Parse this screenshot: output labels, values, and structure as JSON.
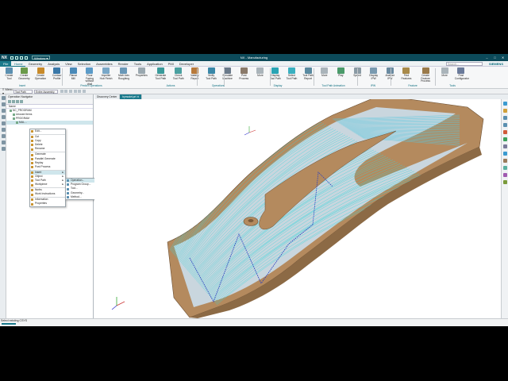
{
  "titlebar": {
    "app": "NX",
    "window_menu": "Window",
    "title": "NX - Manufacturing",
    "brand": "SIEMENS"
  },
  "menu": {
    "file": "File",
    "tabs": [
      "Home",
      "Geometry",
      "Analysis",
      "View",
      "Selection",
      "Assemblies",
      "Render",
      "Tools",
      "Application",
      "PMI",
      "Developer"
    ],
    "search_placeholder": "Search..."
  },
  "ribbon": {
    "buttons": [
      {
        "l1": "Create",
        "l2": "Tool",
        "color": "#5a8fb0"
      },
      {
        "l1": "Create",
        "l2": "Geometry",
        "color": "#6a9a4a"
      },
      {
        "l1": "Create",
        "l2": "Operation",
        "color": "#c88a2a"
      },
      {
        "l1": "Contour",
        "l2": "Profile",
        "color": "#3a78a8"
      },
      {
        "l1": "Planar",
        "l2": "Mill",
        "color": "#4a8ab8"
      },
      {
        "l1": "Floor Facing",
        "l2": "without Wall",
        "color": "#5b9bc8"
      },
      {
        "l1": "Impeller",
        "l2": "Hub Finish",
        "color": "#7aa8c8"
      },
      {
        "l1": "Multi Axis",
        "l2": "Roughing",
        "color": "#6a98b8"
      },
      {
        "l1": "Properties",
        "l2": "",
        "color": "#9aa8b0"
      },
      {
        "l1": "Generate",
        "l2": "Tool Path",
        "color": "#3a9a9a"
      },
      {
        "l1": "Check",
        "l2": "Tool Path",
        "color": "#4aa0a0"
      },
      {
        "l1": "Validity",
        "l2": "Report",
        "color": "#b87a3a"
      },
      {
        "l1": "Verify",
        "l2": "Tool Path",
        "color": "#3a88a8"
      },
      {
        "l1": "Simulate",
        "l2": "Machine",
        "color": "#6a7a8a"
      },
      {
        "l1": "Post",
        "l2": "Process",
        "color": "#8a7a6a"
      },
      {
        "l1": "More",
        "l2": "",
        "color": "#aab4ba"
      },
      {
        "l1": "Display",
        "l2": "Tool Path",
        "color": "#2aa4b4"
      },
      {
        "l1": "Select",
        "l2": "Tool Path",
        "color": "#3ab0c0"
      },
      {
        "l1": "Tool Path",
        "l2": "Report",
        "color": "#5a8aa0"
      },
      {
        "l1": "More",
        "l2": "",
        "color": "#aab4ba"
      },
      {
        "l1": "Play",
        "l2": "",
        "color": "#4a9a6a"
      },
      {
        "l1": "Speed",
        "l2": "",
        "color": "#8a9aa4"
      },
      {
        "l1": "Display",
        "l2": "IPW",
        "color": "#7a9ab0"
      },
      {
        "l1": "Analyze",
        "l2": "IPW",
        "color": "#6a8aa0"
      },
      {
        "l1": "Find",
        "l2": "Features",
        "color": "#a88a4a"
      },
      {
        "l1": "Create Feature",
        "l2": "Process",
        "color": "#9a7a4a"
      },
      {
        "l1": "More",
        "l2": "",
        "color": "#aab4ba"
      },
      {
        "l1": "Post",
        "l2": "Configurator",
        "color": "#6a7a9a"
      }
    ],
    "groups": [
      "Insert",
      "Predict Operations",
      "Actions",
      "Operations",
      "Display",
      "Tool Path Animation",
      "IPW",
      "Feature",
      "Tools"
    ]
  },
  "cmdbar": {
    "menu": "Menu",
    "filter": "Tool Path",
    "scope": "Entire Assembly"
  },
  "navigator": {
    "title": "Operation Navigator",
    "column": "Name",
    "tree": [
      {
        "label": "NC_PROGRAM",
        "indent": 1
      },
      {
        "label": "Unused Items",
        "indent": 2
      },
      {
        "label": "PROGRAM",
        "indent": 2
      },
      {
        "label": "MUL...",
        "indent": 3
      }
    ]
  },
  "context_menu": {
    "items": [
      "Edit...",
      "Cut",
      "Copy",
      "Delete",
      "Rename",
      "Generate",
      "Parallel Generate",
      "Replay",
      "Post Process",
      "Insert",
      "Object",
      "Tool Path",
      "Workpiece",
      "Nurbs",
      "Work Instructions",
      "Information",
      "Properties"
    ]
  },
  "sub_menu": {
    "items": [
      "Operation...",
      "Program Group...",
      "Tool...",
      "Geometry...",
      "Method..."
    ]
  },
  "graphics": {
    "tabs": [
      "Discovery Center",
      "bymodel.prt"
    ]
  },
  "status": {
    "prompt": "Select existing CSYS"
  },
  "colors": {
    "accent": "#1a7a8c",
    "part": "#b48a5e",
    "toolpath": "#39d6dc"
  }
}
